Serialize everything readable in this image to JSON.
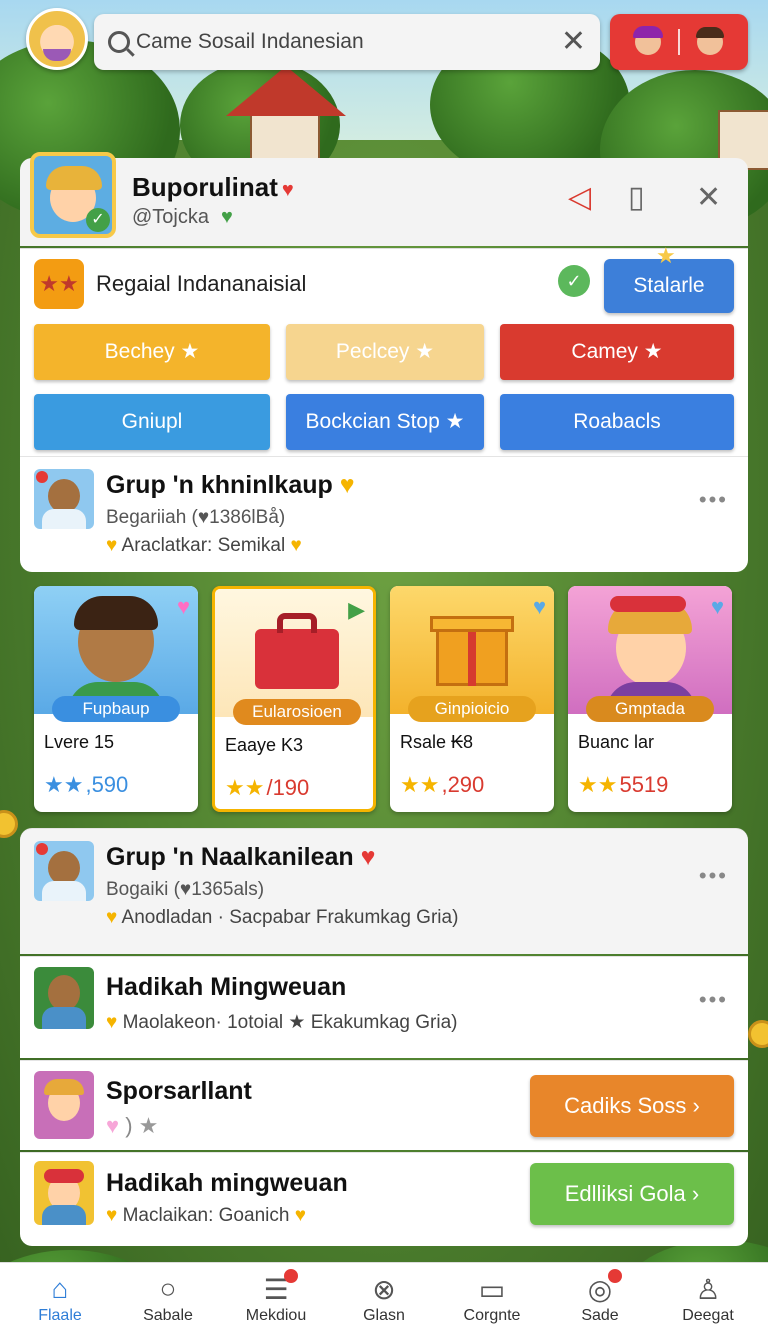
{
  "search": {
    "placeholder": "Came Sosail Indanesian"
  },
  "profile": {
    "name": "Buporulinat",
    "handle": "@Tojcka"
  },
  "region": {
    "label": "Regaial Indananaisial",
    "start_label": "Stalarle"
  },
  "categories": [
    {
      "label": "Bechey ★",
      "color": "#f4b42b"
    },
    {
      "label": "Peclcey ★",
      "color": "#f6d58f"
    },
    {
      "label": "Camey ★",
      "color": "#d93a2f"
    },
    {
      "label": "Gniupl",
      "color": "#3a9be0"
    },
    {
      "label": "Bockcian Stop ★",
      "color": "#3a7fe0"
    },
    {
      "label": "Roabacls",
      "color": "#3a7fe0"
    }
  ],
  "group1": {
    "title": "Grup 'n khninlkaup",
    "subtitle": "Begariiah (♥1386lBå)",
    "meta": "Araclatkar: Semikal"
  },
  "tiles": [
    {
      "tag": "Fupbaup",
      "label": "Lvere 15",
      "price": ",590",
      "price_color": "#3a8fe0",
      "tag_color": "#3a8fe0"
    },
    {
      "tag": "Eularosioen",
      "label": "Eaaye K3",
      "price": "/190",
      "price_color": "#d93a2f",
      "tag_color": "#e08a1e"
    },
    {
      "tag": "Ginpioicio",
      "label": "Rsale ₭8",
      "price": ",290",
      "price_color": "#d93a2f",
      "tag_color": "#e6a21e"
    },
    {
      "tag": "Gmptada",
      "label": "Buanc lar",
      "price": "5519",
      "price_color": "#d93a2f",
      "tag_color": "#d98a1e"
    }
  ],
  "group2": {
    "title": "Grup 'n Naalkanilean",
    "subtitle": "Bogaiki (♥1365als)",
    "meta": "Anodladan · Sacpabar Frakumkag Gria)"
  },
  "weekly1": {
    "title": "Hadikah Mingweuan",
    "meta": "Maolakeon· 1otoial ★ Ekakumkag Gria)"
  },
  "sponsor": {
    "title": "Sporsarllant",
    "cta": "Cadiks Soss ›"
  },
  "weekly2": {
    "title": "Hadikah mingweuan",
    "meta": "Maclaikan: Goanich",
    "cta": "Edlliksi Gola ›"
  },
  "nav": [
    {
      "label": "Flaale",
      "icon": "home-icon"
    },
    {
      "label": "Sabale",
      "icon": "search-icon"
    },
    {
      "label": "Mekdiou",
      "icon": "menu-icon"
    },
    {
      "label": "Glasn",
      "icon": "compass-icon"
    },
    {
      "label": "Corgnte",
      "icon": "chat-icon"
    },
    {
      "label": "Sade",
      "icon": "game-icon"
    },
    {
      "label": "Deegat",
      "icon": "profile-icon"
    }
  ]
}
